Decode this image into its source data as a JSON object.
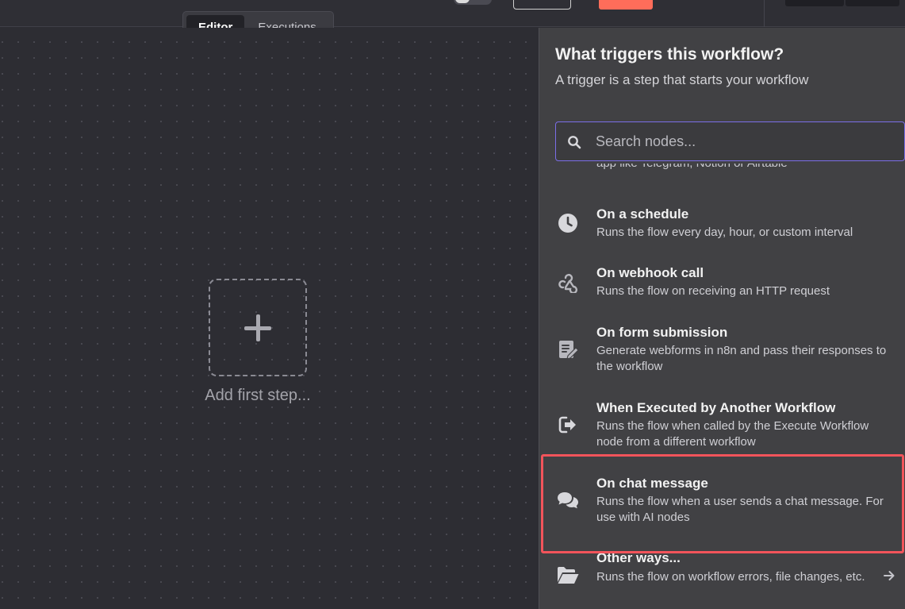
{
  "tabs": [
    {
      "label": "Editor",
      "active": true
    },
    {
      "label": "Executions",
      "active": false
    }
  ],
  "canvas": {
    "add_step_label": "Add first step..."
  },
  "panel": {
    "title": "What triggers this workflow?",
    "subtitle": "A trigger is a step that starts your workflow",
    "search": {
      "placeholder": "Search nodes...",
      "value": ""
    },
    "cut_off_text": "app like Telegram, Notion or Airtable",
    "items": [
      {
        "icon": "clock-icon",
        "title": "On a schedule",
        "desc": "Runs the flow every day, hour, or custom interval"
      },
      {
        "icon": "webhook-icon",
        "title": "On webhook call",
        "desc": "Runs the flow on receiving an HTTP request"
      },
      {
        "icon": "form-icon",
        "title": "On form submission",
        "desc": "Generate webforms in n8n and pass their responses to the workflow"
      },
      {
        "icon": "sign-in-icon",
        "title": "When Executed by Another Workflow",
        "desc": "Runs the flow when called by the Execute Workflow node from a different workflow"
      },
      {
        "icon": "chat-icon",
        "title": "On chat message",
        "desc": "Runs the flow when a user sends a chat message. For use with AI nodes"
      },
      {
        "icon": "folder-open-icon",
        "title": "Other ways...",
        "desc": "Runs the flow on workflow errors, file changes, etc."
      }
    ]
  },
  "colors": {
    "accent_save": "#ff6d5a",
    "search_border": "#7b6ee8",
    "highlight": "#f2545b"
  }
}
